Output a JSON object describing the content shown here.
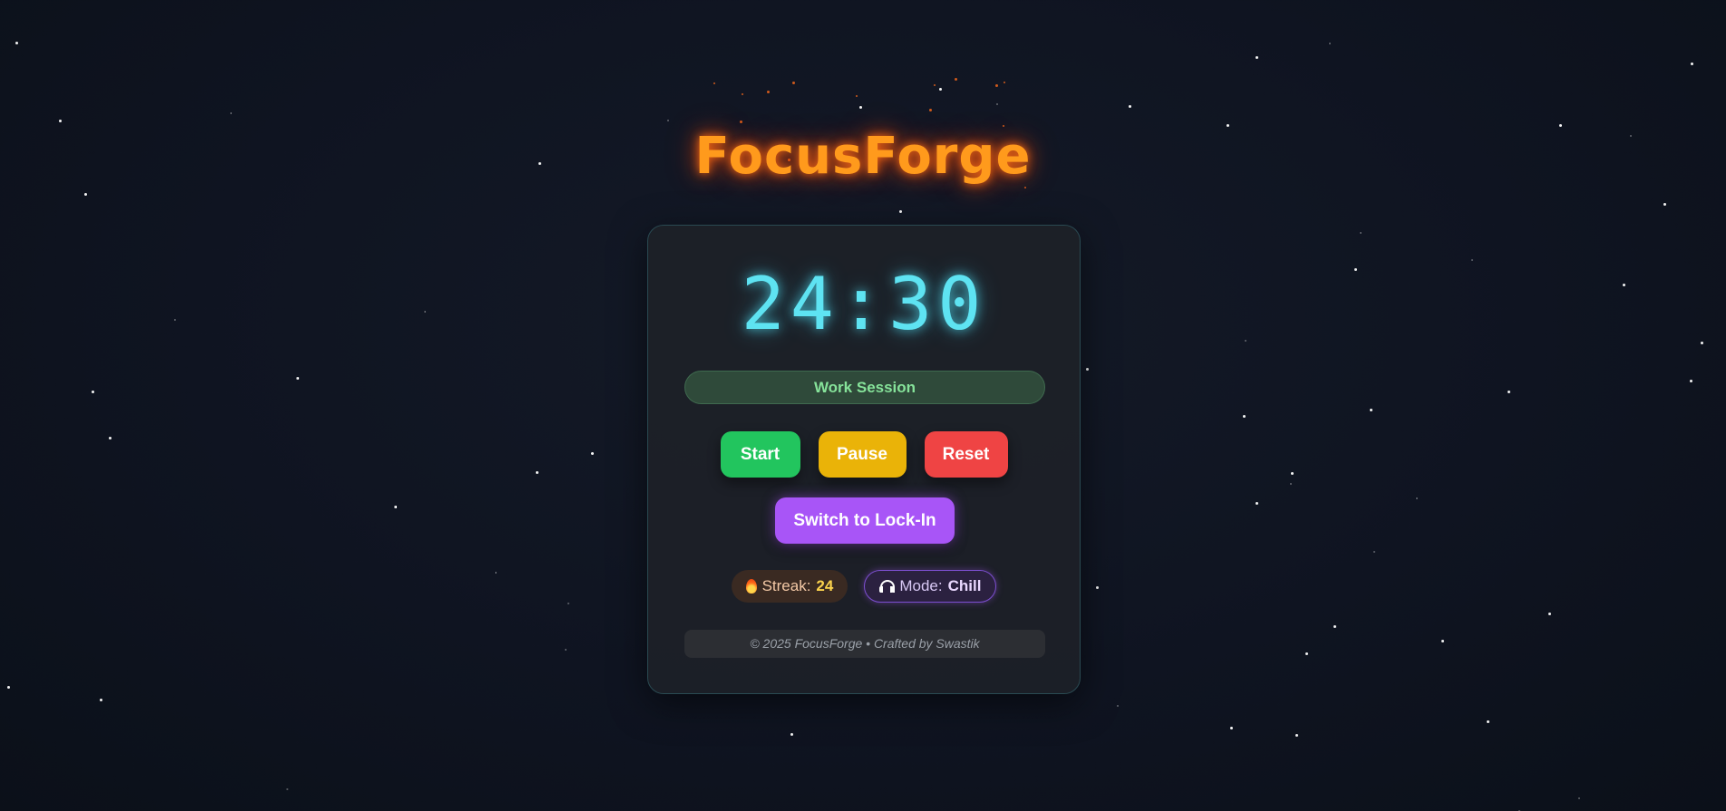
{
  "app": {
    "title": "FocusForge"
  },
  "timer": {
    "display": "24:30"
  },
  "session": {
    "label": "Work Session"
  },
  "controls": {
    "start_label": "Start",
    "pause_label": "Pause",
    "reset_label": "Reset",
    "switch_label": "Switch to Lock-In"
  },
  "stats": {
    "streak_label": "Streak:",
    "streak_value": "24",
    "streak_icon": "fire-icon",
    "mode_label": "Mode:",
    "mode_value": "Chill",
    "mode_icon": "headphones-icon"
  },
  "footer": {
    "text": "© 2025 FocusForge • Crafted by Swastik"
  },
  "colors": {
    "title": "#ff9a1c",
    "timer": "#5ee3f2",
    "start": "#22c55e",
    "pause": "#eab308",
    "reset": "#ef4444",
    "switch": "#a855f7",
    "session_text": "#86e39a"
  }
}
